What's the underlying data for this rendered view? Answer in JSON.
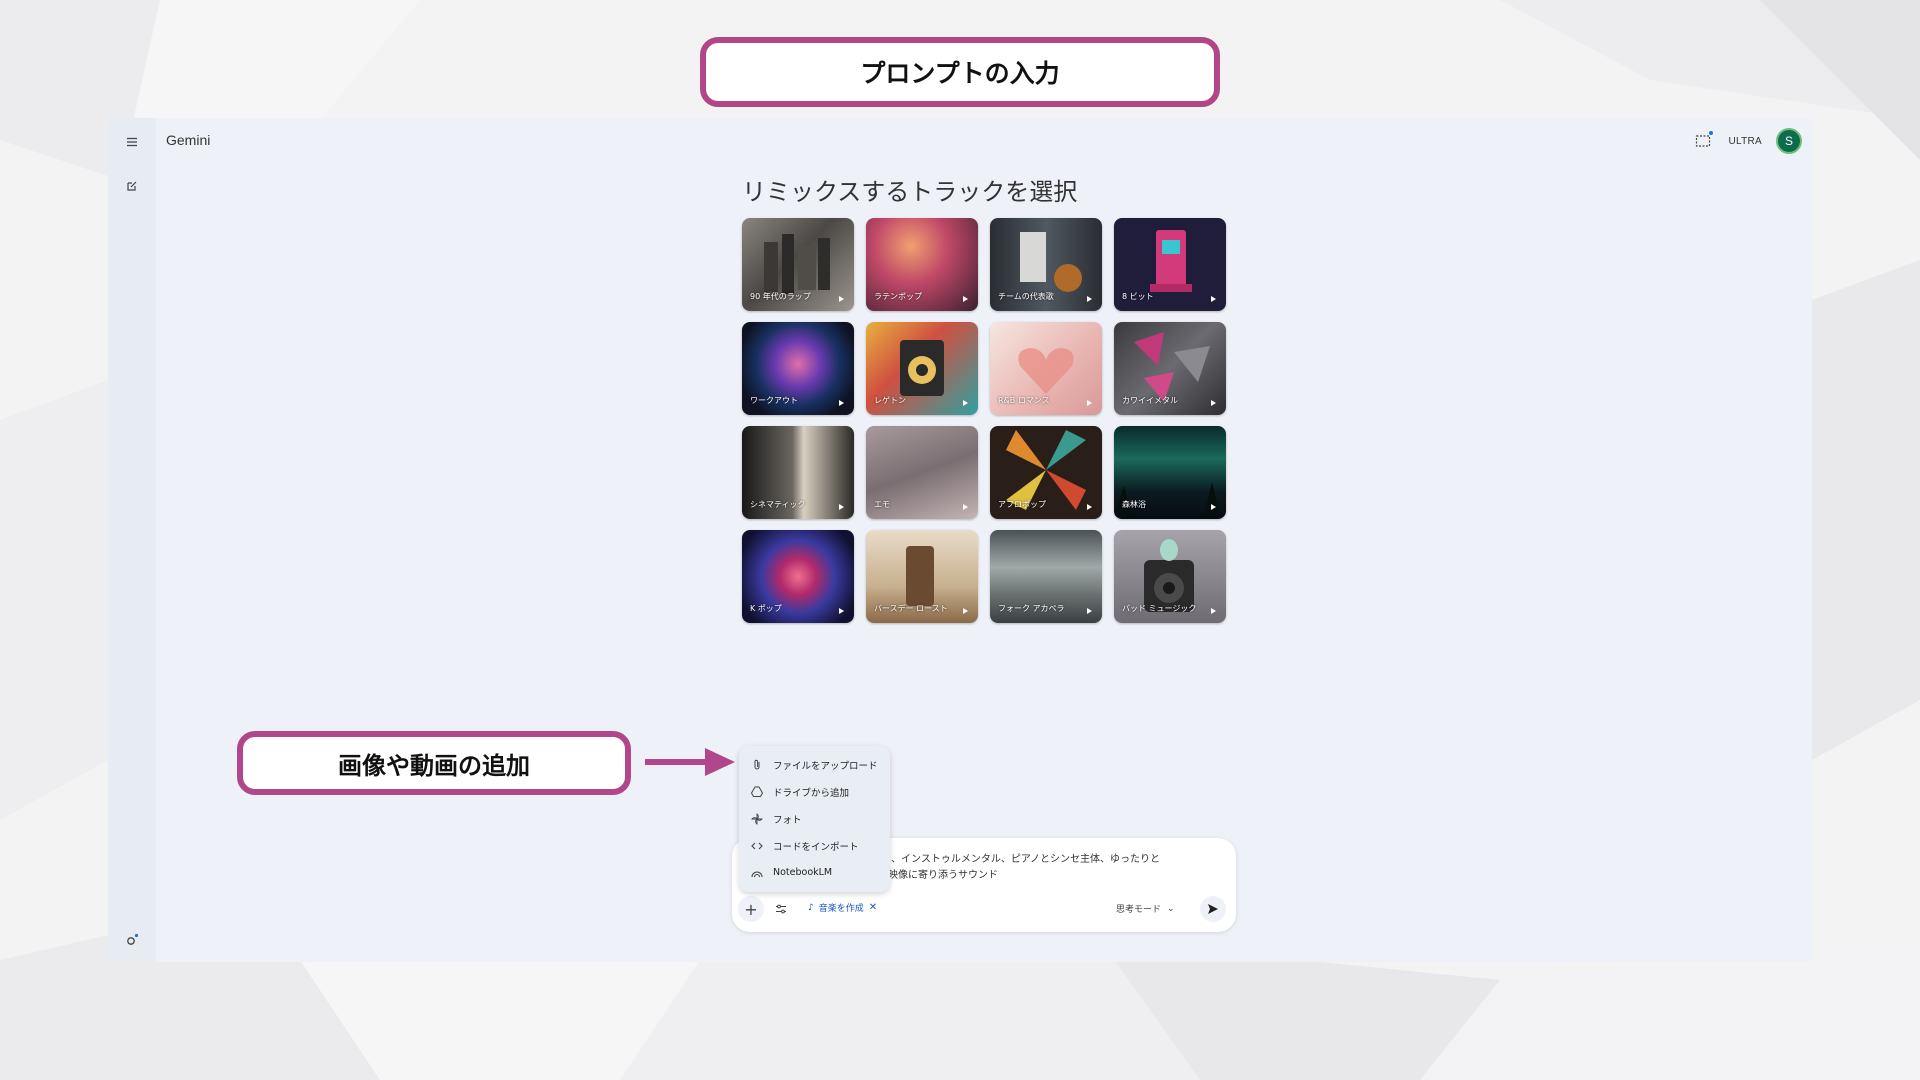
{
  "callouts": {
    "top": "プロンプトの入力",
    "left": "画像や動画の追加"
  },
  "app": {
    "title": "Gemini",
    "plan_badge": "ULTRA",
    "avatar_letter": "S"
  },
  "main": {
    "heading": "リミックスするトラックを選択",
    "tracks": [
      {
        "label": "90 年代のラップ"
      },
      {
        "label": "ラテンポップ"
      },
      {
        "label": "チームの代表歌"
      },
      {
        "label": "8 ビット"
      },
      {
        "label": "ワークアウト"
      },
      {
        "label": "レゲトン"
      },
      {
        "label": "R&B ロマンス"
      },
      {
        "label": "カワイイメタル"
      },
      {
        "label": "シネマティック"
      },
      {
        "label": "エモ"
      },
      {
        "label": "アフロポップ"
      },
      {
        "label": "森林浴"
      },
      {
        "label": "K ポップ"
      },
      {
        "label": "バースデー ロースト"
      },
      {
        "label": "フォーク アカペラ"
      },
      {
        "label": "バッド ミュージック"
      }
    ]
  },
  "menu": {
    "items": [
      {
        "label": "ファイルをアップロード",
        "icon": "paperclip-icon"
      },
      {
        "label": "ドライブから追加",
        "icon": "drive-icon"
      },
      {
        "label": "フォト",
        "icon": "photos-icon"
      },
      {
        "label": "コードをインポート",
        "icon": "code-icon"
      },
      {
        "label": "NotebookLM",
        "icon": "notebooklm-icon"
      }
    ]
  },
  "input": {
    "text_line1": "トBGM、インストゥルメンタル、ピアノとシンセ主体、ゆったりと",
    "text_line2": "えめ、映像に寄り添うサウンド",
    "chip_label": "音楽を作成",
    "mode_label": "思考モード"
  },
  "colors": {
    "callout_border": "#b2468a",
    "accent": "#1a55c6",
    "avatar_bg": "#0d6b4e"
  }
}
